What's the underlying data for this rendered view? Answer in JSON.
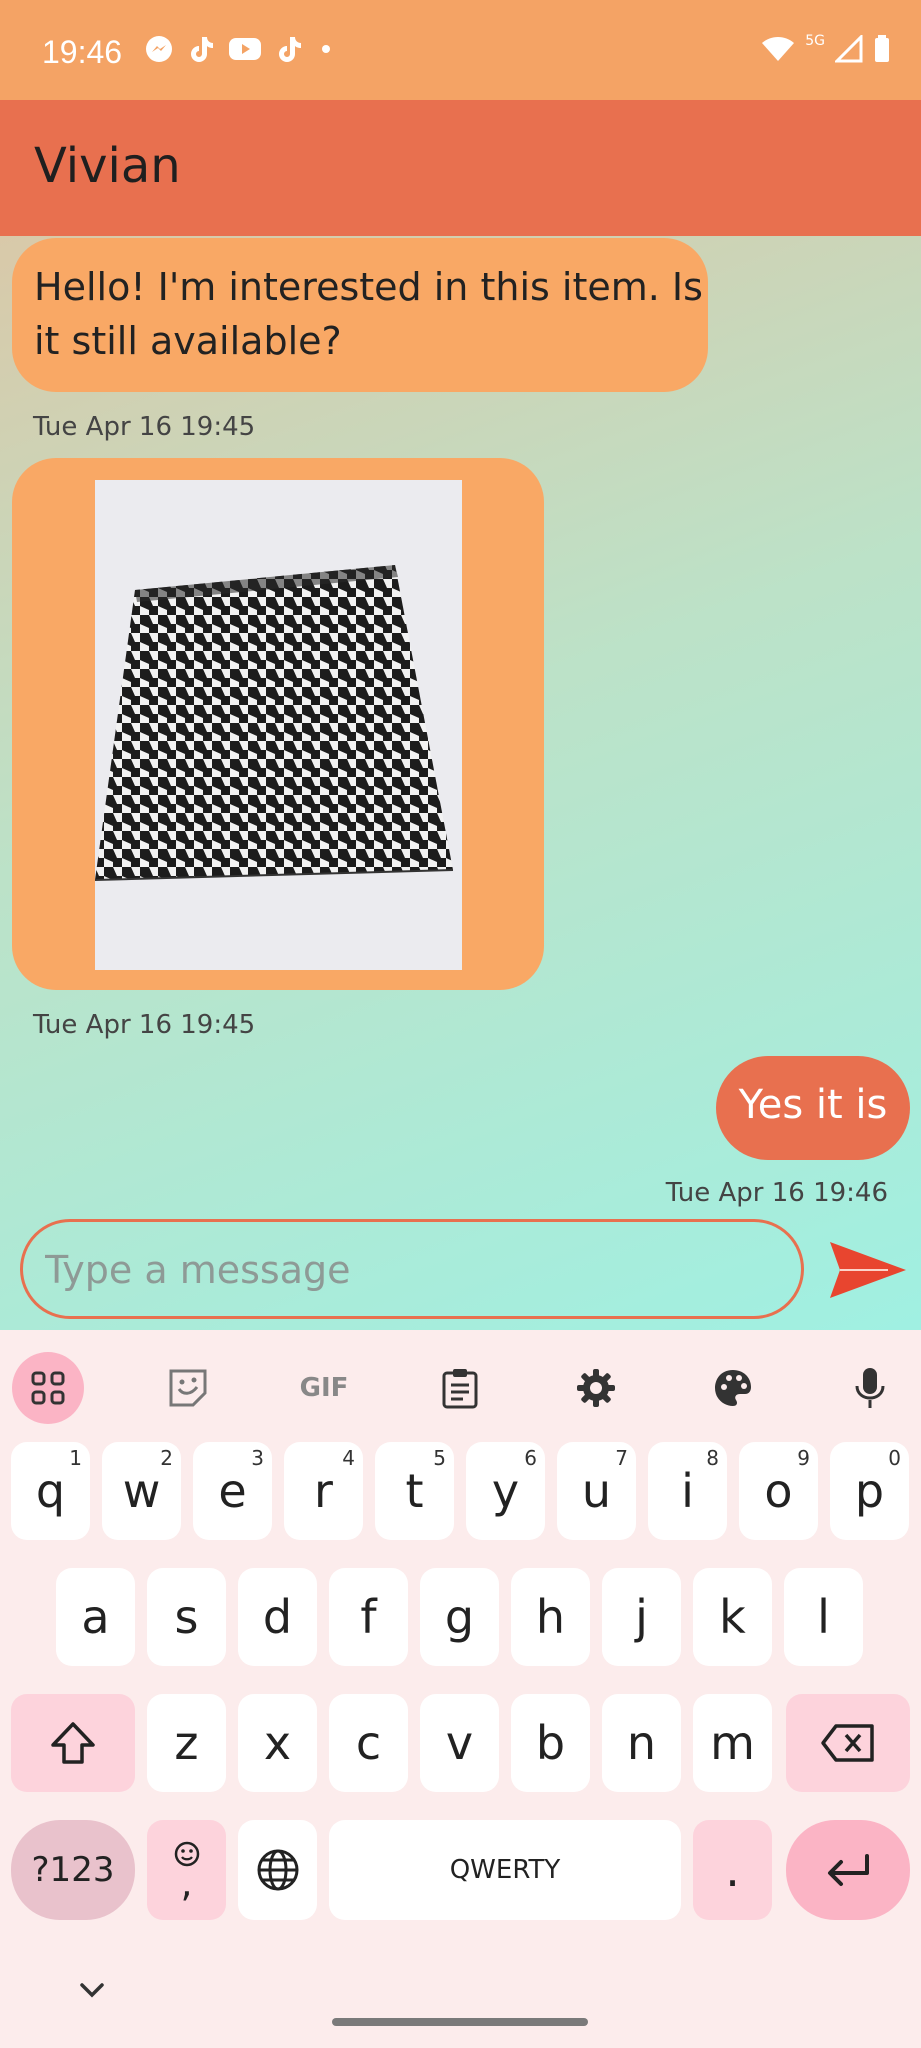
{
  "status_bar": {
    "time": "19:46",
    "notification_icons": [
      "messenger-icon",
      "tiktok-icon",
      "youtube-icon",
      "tiktok-icon",
      "dot-icon"
    ],
    "network": "5G",
    "system_icons": [
      "wifi-icon",
      "signal-icon",
      "battery-icon"
    ]
  },
  "app_bar": {
    "title": "Vivian"
  },
  "messages": [
    {
      "direction": "incoming",
      "type": "text",
      "text": "Hello! I'm interested in this item. Is it still available?",
      "timestamp": "Tue Apr 16 19:45"
    },
    {
      "direction": "incoming",
      "type": "image",
      "image_description": "houndstooth-skirt-photo",
      "timestamp": "Tue Apr 16 19:45"
    },
    {
      "direction": "outgoing",
      "type": "text",
      "text": "Yes it is",
      "timestamp": "Tue Apr 16 19:46"
    }
  ],
  "composer": {
    "placeholder": "Type a message",
    "value": ""
  },
  "keyboard": {
    "toolbar": [
      "apps-grid-icon",
      "sticker-icon",
      "gif-icon",
      "clipboard-icon",
      "settings-icon",
      "palette-icon",
      "mic-icon"
    ],
    "gif_label": "GIF",
    "row1": [
      {
        "k": "q",
        "s": "1"
      },
      {
        "k": "w",
        "s": "2"
      },
      {
        "k": "e",
        "s": "3"
      },
      {
        "k": "r",
        "s": "4"
      },
      {
        "k": "t",
        "s": "5"
      },
      {
        "k": "y",
        "s": "6"
      },
      {
        "k": "u",
        "s": "7"
      },
      {
        "k": "i",
        "s": "8"
      },
      {
        "k": "o",
        "s": "9"
      },
      {
        "k": "p",
        "s": "0"
      }
    ],
    "row2": [
      "a",
      "s",
      "d",
      "f",
      "g",
      "h",
      "j",
      "k",
      "l"
    ],
    "row3": [
      "z",
      "x",
      "c",
      "v",
      "b",
      "n",
      "m"
    ],
    "symbols_label": "?123",
    "emoji_comma": ",",
    "space_label": "QWERTY",
    "period_label": "."
  },
  "colors": {
    "status_bar": "#f4a365",
    "app_bar": "#e8704f",
    "incoming_bubble": "#f9a865",
    "outgoing_bubble": "#e8704f",
    "accent": "#e8704f"
  }
}
